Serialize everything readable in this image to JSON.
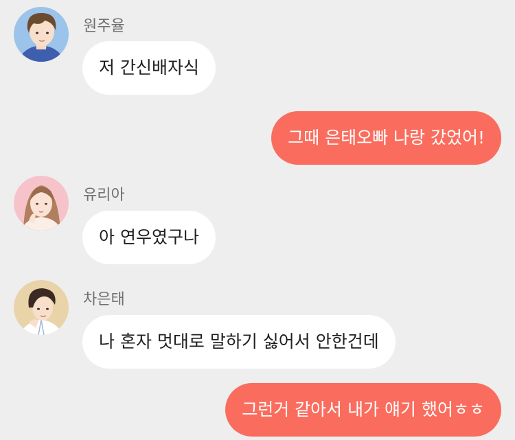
{
  "messages": [
    {
      "sender": "원주율",
      "avatar_icon": "boy-blue-avatar-icon",
      "text": "저 간신배자식"
    },
    {
      "outgoing": true,
      "text": "그때 은태오빠 나랑 갔었어!"
    },
    {
      "sender": "유리아",
      "avatar_icon": "girl-pink-avatar-icon",
      "text": "아 연우였구나"
    },
    {
      "sender": "차은태",
      "avatar_icon": "boy-tan-avatar-icon",
      "text": "나 혼자 멋대로 말하기 싫어서 안한건데"
    },
    {
      "outgoing": true,
      "text": "그런거 같아서 내가 얘기 했어ㅎㅎ"
    }
  ],
  "colors": {
    "background": "#eeeeee",
    "incoming_bubble": "#ffffff",
    "outgoing_bubble": "#fa6d5e",
    "sender_name": "#6f6f6f"
  }
}
